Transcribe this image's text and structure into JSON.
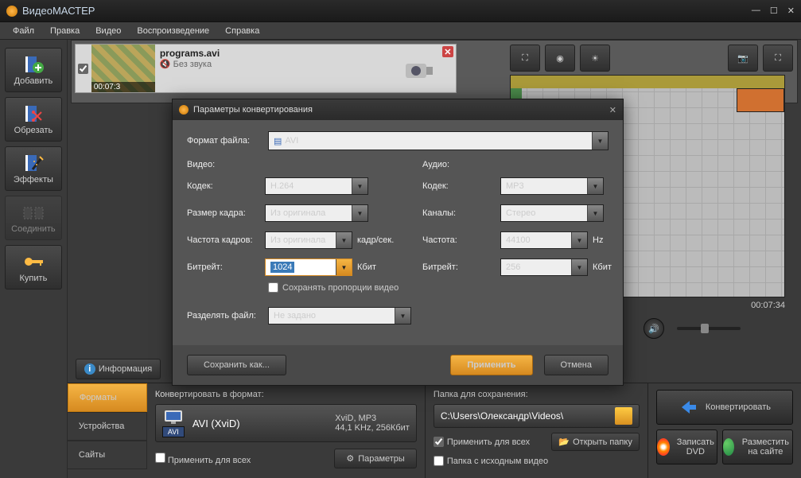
{
  "app": {
    "title": "ВидеоМАСТЕР"
  },
  "menu": [
    "Файл",
    "Правка",
    "Видео",
    "Воспроизведение",
    "Справка"
  ],
  "sidebar": {
    "add": "Добавить",
    "cut": "Обрезать",
    "effects": "Эффекты",
    "join": "Соединить",
    "buy": "Купить"
  },
  "file": {
    "name": "programs.avi",
    "audio_status": "Без звука",
    "duration": "00:07:3"
  },
  "info_btn": "Информация",
  "tabs": {
    "formats": "Форматы",
    "devices": "Устройства",
    "sites": "Сайты"
  },
  "format_panel": {
    "header": "Конвертировать в формат:",
    "name": "AVI (XviD)",
    "badge": "AVI",
    "line1": "XviD, MP3",
    "line2": "44,1 KHz, 256Кбит",
    "apply_all": "Применить для всех",
    "params_btn": "Параметры"
  },
  "save_panel": {
    "header": "Папка для сохранения:",
    "path": "C:\\Users\\Олександр\\Videos\\",
    "apply_all": "Применить для всех",
    "same_folder": "Папка с исходным видео",
    "open_btn": "Открыть папку"
  },
  "actions": {
    "convert": "Конвертировать",
    "burn": "Записать DVD",
    "publish": "Разместить на сайте"
  },
  "preview": {
    "time": "00:07:34"
  },
  "dialog": {
    "title": "Параметры конвертирования",
    "file_format_label": "Формат файла:",
    "file_format": "AVI",
    "video_header": "Видео:",
    "audio_header": "Аудио:",
    "video": {
      "codec_label": "Кодек:",
      "codec": "H.264",
      "size_label": "Размер кадра:",
      "size": "Из оригинала",
      "fps_label": "Частота кадров:",
      "fps": "Из оригинала",
      "fps_unit": "кадр/сек.",
      "bitrate_label": "Битрейт:",
      "bitrate": "1024",
      "bitrate_unit": "Кбит",
      "keep_aspect": "Сохранять пропорции видео"
    },
    "audio": {
      "codec_label": "Кодек:",
      "codec": "MP3",
      "channels_label": "Каналы:",
      "channels": "Стерео",
      "freq_label": "Частота:",
      "freq": "44100",
      "freq_unit": "Hz",
      "bitrate_label": "Битрейт:",
      "bitrate": "256",
      "bitrate_unit": "Кбит"
    },
    "split_label": "Разделять файл:",
    "split_value": "Не задано",
    "save_as": "Сохранить как...",
    "apply": "Применить",
    "cancel": "Отмена"
  }
}
